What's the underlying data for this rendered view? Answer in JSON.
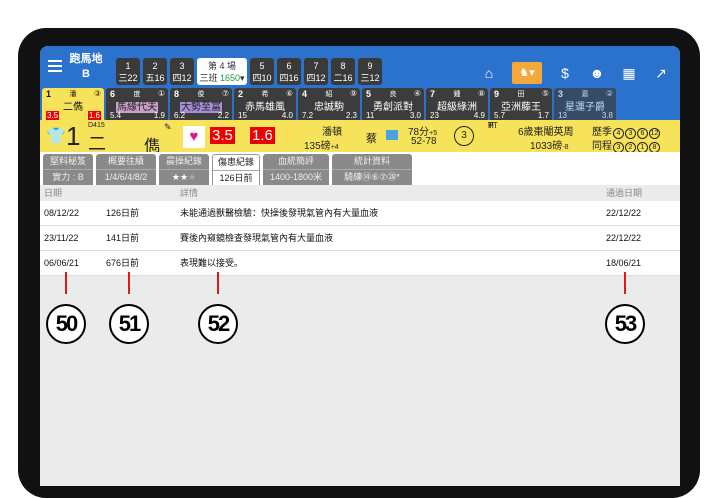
{
  "header": {
    "venue": "跑馬地",
    "course": "B"
  },
  "races": [
    {
      "no": "1",
      "cls": "三",
      "dist": "22"
    },
    {
      "no": "2",
      "cls": "五",
      "dist": "16"
    },
    {
      "no": "3",
      "cls": "四",
      "dist": "12"
    },
    {
      "no": "5",
      "cls": "四",
      "dist": "10"
    },
    {
      "no": "6",
      "cls": "四",
      "dist": "16"
    },
    {
      "no": "7",
      "cls": "四",
      "dist": "12"
    },
    {
      "no": "8",
      "cls": "二",
      "dist": "16"
    },
    {
      "no": "9",
      "cls": "三",
      "dist": "12"
    }
  ],
  "current_race": {
    "label": "第 4 場",
    "cls": "三班",
    "dist": "1650"
  },
  "toolbar_icons": [
    "home-icon",
    "horse-icon",
    "odds-icon",
    "jockey-icon",
    "table-icon",
    "chart-icon"
  ],
  "horses": [
    {
      "no": "1",
      "jockey": "潘",
      "draw": "③",
      "name": "二儁",
      "win": "3.5",
      "place": "1.6"
    },
    {
      "no": "6",
      "jockey": "度",
      "draw": "①",
      "name": "馬緣代夫",
      "win": "5.4",
      "place": "1.9"
    },
    {
      "no": "8",
      "jockey": "俊",
      "draw": "⑦",
      "name": "大勢至富",
      "win": "6.2",
      "place": "2.2"
    },
    {
      "no": "2",
      "jockey": "希",
      "draw": "⑥",
      "name": "赤馬雄風",
      "win": "15",
      "place": "4.0"
    },
    {
      "no": "4",
      "jockey": "紹",
      "draw": "⑨",
      "name": "忠誠駒",
      "win": "7.2",
      "place": "2.3"
    },
    {
      "no": "5",
      "jockey": "良",
      "draw": "④",
      "name": "勇創派對",
      "win": "11",
      "place": "3.0"
    },
    {
      "no": "7",
      "jockey": "鍾",
      "draw": "⑧",
      "name": "超級綠洲",
      "win": "23",
      "place": "4.9"
    },
    {
      "no": "9",
      "jockey": "田",
      "draw": "⑤",
      "name": "亞洲藤王",
      "win": "5.7",
      "place": "1.7"
    },
    {
      "no": "3",
      "jockey": "嘉",
      "draw": "②",
      "name": "星運子爵",
      "win": "13",
      "place": "3.8"
    }
  ],
  "info": {
    "number": "1",
    "code": "D415",
    "name_part1": "二",
    "name_part2": "儁",
    "win": "3.5",
    "place": "1.6",
    "jockey": "潘頓",
    "weight": "135磅",
    "weight_diff": "+4",
    "trainer": "蔡",
    "rating": "78分",
    "rating_diff": "+5",
    "rating_range": "52-78",
    "draw": "3",
    "gear1": "H",
    "gear2": "P",
    "gear3": "TT",
    "age_origin": "6歲棗閹英周",
    "body_weight": "1033磅",
    "body_diff": "-8",
    "season_label": "歷季",
    "season": [
      "4",
      "3",
      "6",
      "12"
    ],
    "same_label": "同程",
    "same": [
      "3",
      "2",
      "1",
      "8"
    ]
  },
  "tabs": [
    {
      "title": "堅料秘笈",
      "sub": "實力 : B"
    },
    {
      "title": "概要往績",
      "sub": "1/4/6/4/8/2"
    },
    {
      "title": "晨操紀錄",
      "sub": "★★★",
      "stars": 2
    },
    {
      "title": "傷患紀錄",
      "sub": "126日前"
    },
    {
      "title": "血統簡評",
      "sub": "1400-1800米"
    },
    {
      "title": "統計資料",
      "sub": "騎練⑭⑥⑦㉘*"
    }
  ],
  "table": {
    "headers": [
      "日期",
      "詳情",
      "通過日期"
    ],
    "rows": [
      {
        "date": "08/12/22",
        "ago": "126日前",
        "detail": "未能通過獸醫檢驗：快操後發現氣管內有大量血液",
        "pass": "22/12/22"
      },
      {
        "date": "23/11/22",
        "ago": "141日前",
        "detail": "賽後內窺鏡檢查發現氣管內有大量血液",
        "pass": "22/12/22"
      },
      {
        "date": "06/06/21",
        "ago": "676日前",
        "detail": "表現難以接受。",
        "pass": "18/06/21"
      }
    ]
  },
  "annotations": [
    "50",
    "51",
    "52",
    "53"
  ]
}
